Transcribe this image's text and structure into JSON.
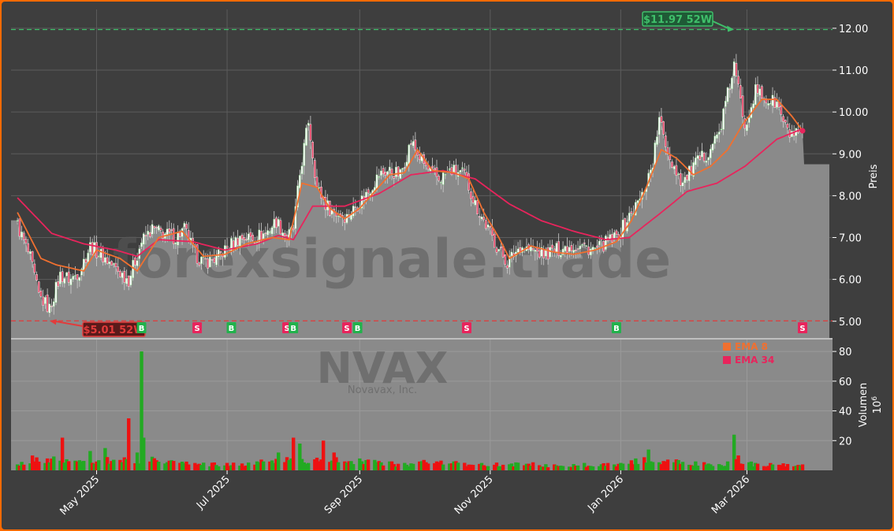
{
  "chart_data": {
    "type": "candlestick",
    "ticker": "NVAX",
    "company": "Novavax, Inc.",
    "watermark": "forexsignale.trade",
    "price_axis_label": "Preis",
    "volume_axis_label": "Volumen",
    "volume_unit": "10",
    "volume_unit_exp": "6",
    "price_ylim": [
      4.6,
      12.45
    ],
    "price_ticks": [
      "5.00",
      "6.00",
      "7.00",
      "8.00",
      "9.00",
      "10.00",
      "11.00",
      "12.00"
    ],
    "volume_ylim": [
      0,
      88
    ],
    "volume_ticks": [
      "20",
      "40",
      "60",
      "80"
    ],
    "x_ticks": [
      {
        "label": "May 2025",
        "date": "2025-05-01"
      },
      {
        "label": "Jul 2025",
        "date": "2025-07-01"
      },
      {
        "label": "Sep 2025",
        "date": "2025-09-01"
      },
      {
        "label": "Nov 2025",
        "date": "2025-11-01"
      },
      {
        "label": "Jan 2026",
        "date": "2026-01-01"
      },
      {
        "label": "Mar 2026",
        "date": "2026-03-01"
      }
    ],
    "high_52w": {
      "value": 11.97,
      "label": "$11.97 52W",
      "date": "2026-02-23"
    },
    "low_52w": {
      "value": 5.01,
      "label": "$5.01 52W",
      "date": "2025-04-09"
    },
    "legend": [
      {
        "name": "EMA 8",
        "color": "#f07030"
      },
      {
        "name": "EMA 34",
        "color": "#e8245c"
      }
    ],
    "colors": {
      "up": "#22aa22",
      "down": "#ee1111",
      "area": "#8a8a8a",
      "background": "#3e3e3e",
      "frame": "#ff6a00"
    },
    "signals": [
      {
        "type": "B",
        "date": "2025-05-22"
      },
      {
        "type": "S",
        "date": "2025-06-17"
      },
      {
        "type": "B",
        "date": "2025-07-03"
      },
      {
        "type": "S",
        "date": "2025-07-29"
      },
      {
        "type": "B",
        "date": "2025-08-01"
      },
      {
        "type": "S",
        "date": "2025-08-26"
      },
      {
        "type": "B",
        "date": "2025-08-31"
      },
      {
        "type": "S",
        "date": "2025-10-21"
      },
      {
        "type": "B",
        "date": "2025-12-30"
      },
      {
        "type": "S",
        "date": "2026-03-27"
      }
    ],
    "price_anchors": {
      "x": [
        "2025-03-25",
        "2025-03-31",
        "2025-04-04",
        "2025-04-09",
        "2025-04-14",
        "2025-04-19",
        "2025-04-23",
        "2025-04-28",
        "2025-05-05",
        "2025-05-11",
        "2025-05-16",
        "2025-05-22",
        "2025-05-27",
        "2025-06-01",
        "2025-06-07",
        "2025-06-11",
        "2025-06-16",
        "2025-06-20",
        "2025-06-26",
        "2025-07-02",
        "2025-07-07",
        "2025-07-13",
        "2025-07-19",
        "2025-07-24",
        "2025-07-29",
        "2025-08-01",
        "2025-08-04",
        "2025-08-08",
        "2025-08-12",
        "2025-08-16",
        "2025-08-20",
        "2025-08-26",
        "2025-08-31",
        "2025-09-05",
        "2025-09-10",
        "2025-09-15",
        "2025-09-20",
        "2025-09-25",
        "2025-09-28",
        "2025-10-03",
        "2025-10-08",
        "2025-10-14",
        "2025-10-20",
        "2025-10-25",
        "2025-10-31",
        "2025-11-04",
        "2025-11-09",
        "2025-11-15",
        "2025-11-20",
        "2025-11-26",
        "2025-12-02",
        "2025-12-08",
        "2025-12-14",
        "2025-12-20",
        "2025-12-26",
        "2025-12-30",
        "2026-01-05",
        "2026-01-11",
        "2026-01-16",
        "2026-01-19",
        "2026-01-24",
        "2026-01-30",
        "2026-02-04",
        "2026-02-10",
        "2026-02-16",
        "2026-02-23",
        "2026-02-28",
        "2026-03-05",
        "2026-03-10",
        "2026-03-15",
        "2026-03-20",
        "2026-03-27"
      ],
      "close": [
        7.3,
        6.5,
        5.6,
        5.3,
        6.1,
        6.0,
        6.2,
        6.8,
        6.5,
        6.2,
        6.0,
        6.9,
        7.2,
        7.1,
        7.0,
        7.2,
        6.6,
        6.4,
        6.5,
        6.8,
        7.0,
        7.0,
        7.1,
        7.4,
        7.0,
        7.2,
        8.5,
        9.8,
        8.2,
        7.8,
        7.6,
        7.5,
        7.8,
        8.1,
        8.5,
        8.6,
        8.5,
        9.3,
        9.0,
        8.6,
        8.4,
        8.6,
        8.5,
        7.8,
        7.2,
        6.8,
        6.4,
        6.8,
        6.7,
        6.6,
        6.7,
        6.8,
        6.8,
        6.7,
        6.9,
        7.0,
        7.5,
        8.0,
        8.8,
        9.8,
        8.9,
        8.3,
        8.7,
        9.0,
        9.5,
        11.1,
        9.7,
        10.5,
        10.3,
        10.2,
        9.5,
        9.4
      ]
    },
    "ema8_anchors": {
      "x": [
        "2025-03-25",
        "2025-04-05",
        "2025-04-12",
        "2025-04-25",
        "2025-05-01",
        "2025-05-12",
        "2025-05-20",
        "2025-05-30",
        "2025-06-10",
        "2025-06-20",
        "2025-06-30",
        "2025-07-10",
        "2025-07-22",
        "2025-07-30",
        "2025-08-05",
        "2025-08-12",
        "2025-08-18",
        "2025-08-25",
        "2025-09-01",
        "2025-09-08",
        "2025-09-15",
        "2025-09-22",
        "2025-09-28",
        "2025-10-05",
        "2025-10-15",
        "2025-10-22",
        "2025-10-29",
        "2025-11-05",
        "2025-11-10",
        "2025-11-20",
        "2025-12-01",
        "2025-12-10",
        "2025-12-20",
        "2025-12-30",
        "2026-01-06",
        "2026-01-13",
        "2026-01-20",
        "2026-01-27",
        "2026-02-04",
        "2026-02-12",
        "2026-02-20",
        "2026-02-27",
        "2026-03-08",
        "2026-03-15",
        "2026-03-22",
        "2026-03-27"
      ],
      "y": [
        7.6,
        6.5,
        6.35,
        6.2,
        6.7,
        6.5,
        6.2,
        7.0,
        7.15,
        6.55,
        6.6,
        6.85,
        7.0,
        6.95,
        8.3,
        8.2,
        7.7,
        7.45,
        7.7,
        8.1,
        8.5,
        8.55,
        9.1,
        8.6,
        8.55,
        8.4,
        7.6,
        7.0,
        6.5,
        6.8,
        6.65,
        6.6,
        6.7,
        6.9,
        7.4,
        8.2,
        9.1,
        8.9,
        8.5,
        8.7,
        9.1,
        9.7,
        10.3,
        10.3,
        9.9,
        9.55
      ]
    },
    "ema34_anchors": {
      "x": [
        "2025-03-25",
        "2025-04-10",
        "2025-04-25",
        "2025-05-10",
        "2025-05-20",
        "2025-05-30",
        "2025-06-15",
        "2025-06-30",
        "2025-07-15",
        "2025-07-25",
        "2025-08-01",
        "2025-08-10",
        "2025-08-25",
        "2025-09-10",
        "2025-09-25",
        "2025-10-10",
        "2025-10-25",
        "2025-11-10",
        "2025-11-25",
        "2025-12-10",
        "2025-12-25",
        "2026-01-05",
        "2026-01-20",
        "2026-02-01",
        "2026-02-15",
        "2026-02-28",
        "2026-03-15",
        "2026-03-27"
      ],
      "y": [
        7.95,
        7.1,
        6.85,
        6.7,
        6.55,
        6.95,
        6.9,
        6.7,
        6.85,
        7.05,
        6.95,
        7.75,
        7.75,
        8.05,
        8.5,
        8.6,
        8.4,
        7.8,
        7.4,
        7.15,
        6.95,
        7.0,
        7.6,
        8.1,
        8.3,
        8.7,
        9.35,
        9.6
      ]
    },
    "volume_anchors": {
      "x": [
        "2025-03-25",
        "2025-04-01",
        "2025-04-08",
        "2025-04-15",
        "2025-04-22",
        "2025-04-28",
        "2025-05-05",
        "2025-05-12",
        "2025-05-16",
        "2025-05-20",
        "2025-05-22",
        "2025-05-23",
        "2025-06-01",
        "2025-06-15",
        "2025-07-01",
        "2025-07-15",
        "2025-07-25",
        "2025-07-31",
        "2025-08-01",
        "2025-08-04",
        "2025-08-10",
        "2025-08-15",
        "2025-08-20",
        "2025-08-25",
        "2025-09-01",
        "2025-09-15",
        "2025-09-22",
        "2025-10-01",
        "2025-10-15",
        "2025-11-01",
        "2025-11-15",
        "2025-12-01",
        "2025-12-15",
        "2026-01-01",
        "2026-01-08",
        "2026-01-14",
        "2026-01-18",
        "2026-01-25",
        "2026-02-05",
        "2026-02-15",
        "2026-02-20",
        "2026-02-23",
        "2026-02-25",
        "2026-03-05",
        "2026-03-15",
        "2026-03-27"
      ],
      "y": [
        4,
        10,
        8,
        22,
        6,
        13,
        15,
        7,
        35,
        12,
        80,
        22,
        8,
        6,
        5,
        6,
        12,
        8,
        22,
        18,
        10,
        20,
        12,
        6,
        8,
        6,
        5,
        7,
        6,
        5,
        6,
        4,
        5,
        5,
        8,
        14,
        16,
        9,
        6,
        5,
        6,
        24,
        10,
        5,
        5,
        4
      ]
    }
  }
}
